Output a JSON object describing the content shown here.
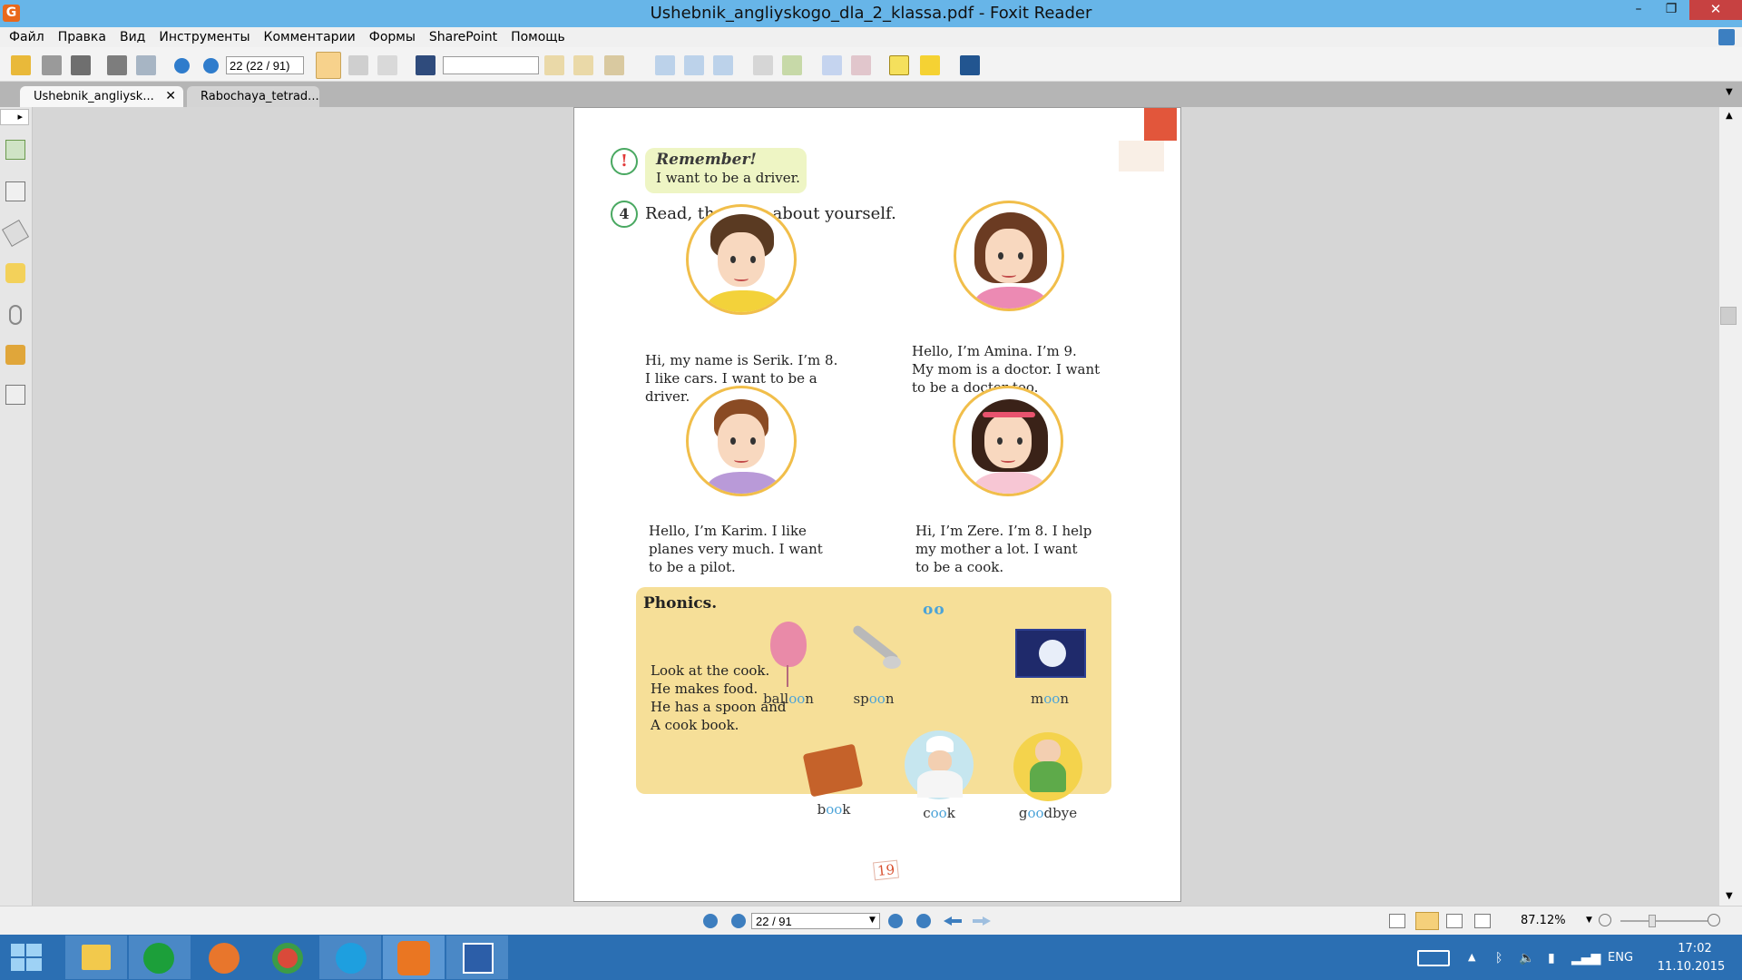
{
  "window": {
    "title": "Ushebnik_angliyskogo_dla_2_klassa.pdf - Foxit Reader",
    "minimize": "–",
    "maximize": "❐",
    "close": "✕"
  },
  "menu": [
    "Файл",
    "Правка",
    "Вид",
    "Инструменты",
    "Комментарии",
    "Формы",
    "SharePoint",
    "Помощь"
  ],
  "toolbar": {
    "page_value": "22 (22 / 91)",
    "search_value": ""
  },
  "tabs": [
    {
      "label": "Ushebnik_angliysk...",
      "close": "✕"
    },
    {
      "label": "Rabochaya_tetrad..."
    }
  ],
  "sidebar": {
    "toggle": "▸"
  },
  "page": {
    "remember_title": "Remember!",
    "remember_text": "I want to be a driver.",
    "remember_mark": "!",
    "ex4_number": "4",
    "ex4_instruction": "Read, then say about yourself.",
    "kids": [
      {
        "lines": [
          "Hi, my name is Serik. I’m 8.",
          "I like cars. I want to be a",
          "driver."
        ]
      },
      {
        "lines": [
          "Hello, I’m Amina. I’m 9.",
          "My mom is a doctor. I want",
          "to be a doctor too."
        ]
      },
      {
        "lines": [
          "Hello, I’m Karim. I like",
          "planes very much. I want",
          "to be a pilot."
        ]
      },
      {
        "lines": [
          "Hi, I’m Zere. I’m 8. I help",
          "my mother a lot. I want",
          "to be a cook."
        ]
      }
    ],
    "phonics_title": "Phonics.",
    "phonics_sound": "oo",
    "phonics_rhyme": [
      "Look at the cook.",
      "He makes food.",
      "He has a spoon and",
      "A cook book."
    ],
    "words": [
      {
        "pre": "ball",
        "oo": "oo",
        "post": "n"
      },
      {
        "pre": "sp",
        "oo": "oo",
        "post": "n"
      },
      {
        "pre": "m",
        "oo": "oo",
        "post": "n"
      },
      {
        "pre": "b",
        "oo": "oo",
        "post": "k"
      },
      {
        "pre": "c",
        "oo": "oo",
        "post": "k"
      },
      {
        "pre": "g",
        "oo": "oo",
        "post": "dbye"
      }
    ],
    "page_number": "19"
  },
  "status": {
    "page_value": "22 / 91",
    "zoom": "87.12%"
  },
  "tray": {
    "lang": "ENG",
    "time": "17:02",
    "date": "11.10.2015"
  },
  "colors": {
    "titlebar": "#67b5e8",
    "taskbar": "#2b6fb3",
    "portrait_ring": "#f1be4a",
    "phonics_bg": "#f6df98",
    "oo_blue": "#4ba3d8"
  }
}
